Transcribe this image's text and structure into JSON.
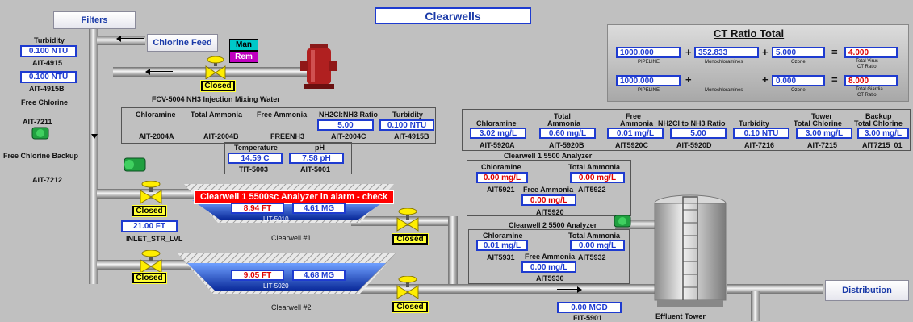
{
  "title": "Clearwells",
  "nav": {
    "filters": "Filters",
    "chlorine_feed": "Chlorine Feed",
    "distribution": "Distribution"
  },
  "mode": {
    "man": "Man",
    "rem": "Rem"
  },
  "turbidity_left": {
    "heading": "Turbidity",
    "value1": "0.100  NTU",
    "tag1": "AIT-4915",
    "value2": "0.100  NTU",
    "tag2": "AIT-4915B",
    "free_chlorine": "Free Chlorine"
  },
  "valves": {
    "fcv_status": "Closed",
    "fcv_label": "FCV-5004 NH3 Injection Mixing Water",
    "v1": "Closed",
    "v2": "Closed",
    "v3": "Closed",
    "v4": "Closed"
  },
  "left_labels": {
    "ait7211": "AIT-7211",
    "backup": "Free Chlorine Backup",
    "ait7212": "AIT-7212"
  },
  "ct": {
    "title": "CT Ratio Total",
    "row1": {
      "a": "1000.000",
      "a_lbl": "PIPELINE",
      "b": "352.833",
      "b_lbl": "Monochloramines",
      "c": "5.000",
      "c_lbl": "Ozone",
      "r": "4.000",
      "r_lbl1": "Total Virus",
      "r_lbl2": "CT Ratio"
    },
    "row2": {
      "a": "1000.000",
      "a_lbl": "PIPELINE",
      "b_lbl": "Monochloramines",
      "c": "0.000",
      "c_lbl": "Ozone",
      "r": "8.000",
      "r_lbl1": "Total Giardia",
      "r_lbl2": "CT Ratio"
    },
    "plus": "+",
    "eq": "="
  },
  "mid_panel": {
    "h1": "Chloramine",
    "h2": "Total Ammonia",
    "h3": "Free Ammonia",
    "h4": "NH2Cl:NH3 Ratio",
    "h5": "Turbidity",
    "v4": "5.00",
    "v5": "0.100  NTU",
    "t1": "AIT-2004A",
    "t2": "AIT-2004B",
    "t3": "FREENH3",
    "t4": "AIT-2004C",
    "t5": "AIT-4915B",
    "temp_h": "Temperature",
    "ph_h": "pH",
    "temp_v": "14.59  C",
    "ph_v": "7.58  pH",
    "temp_t": "TIT-5003",
    "ph_t": "AIT-5001"
  },
  "right_panel": {
    "h1": "Chloramine",
    "h2a": "Total",
    "h2b": "Ammonia",
    "h3a": "Free",
    "h3b": "Ammonia",
    "h4": "NH2Cl to NH3 Ratio",
    "h5": "Turbidity",
    "h6a": "Tower",
    "h6b": "Total Chlorine",
    "h7a": "Backup",
    "h7b": "Total Chlorine",
    "v1": "3.02  mg/L",
    "v2": "0.60  mg/L",
    "v3": "0.01  mg/L",
    "v4": "5.00",
    "v5": "0.10  NTU",
    "v6": "3.00  mg/L",
    "v7": "3.00  mg/L",
    "t1": "AIT-5920A",
    "t2": "AIT-5920B",
    "t3": "AIT5920C",
    "t4": "AIT-5920D",
    "t5": "AIT-7216",
    "t6": "AIT-7215",
    "t7": "AIT7215_01"
  },
  "an1": {
    "title": "Clearwell 1 5500 Analyzer",
    "h1": "Chloramine",
    "h2": "Total Ammonia",
    "v1": "0.00  mg/L",
    "v2": "0.00  mg/L",
    "t1": "AIT5921",
    "fa": "Free Ammonia",
    "t2": "AIT5922",
    "v3": "0.00  mg/L",
    "t3": "AIT5920"
  },
  "an2": {
    "title": "Clearwell 2 5500 Analyzer",
    "h1": "Chloramine",
    "h2": "Total Ammonia",
    "v1": "0.01  mg/L",
    "v2": "0.00  mg/L",
    "t1": "AIT5931",
    "fa": "Free Ammonia",
    "t2": "AIT5932",
    "v3": "0.00  mg/L",
    "t3": "AIT5930"
  },
  "cw1": {
    "alarm": "Clearwell 1 5500sc Analyzer in alarm - check",
    "level": "8.94  FT",
    "volume": "4.61  MG",
    "tag": "LIT-5010",
    "name": "Clearwell #1"
  },
  "cw2": {
    "level": "9.05  FT",
    "volume": "4.68  MG",
    "tag": "LIT-5020",
    "name": "Clearwell #2"
  },
  "inlet": {
    "value": "21.00  FT",
    "tag": "INLET_STR_LVL"
  },
  "flow": {
    "value": "0.00  MGD",
    "tag": "FIT-5901"
  },
  "tower": {
    "name": "Effluent Tower"
  },
  "colors": {
    "value_border": "#1e3bd0",
    "alarm": "#ff0000",
    "valve": "#ffff33",
    "background": "#c0c0c0"
  }
}
